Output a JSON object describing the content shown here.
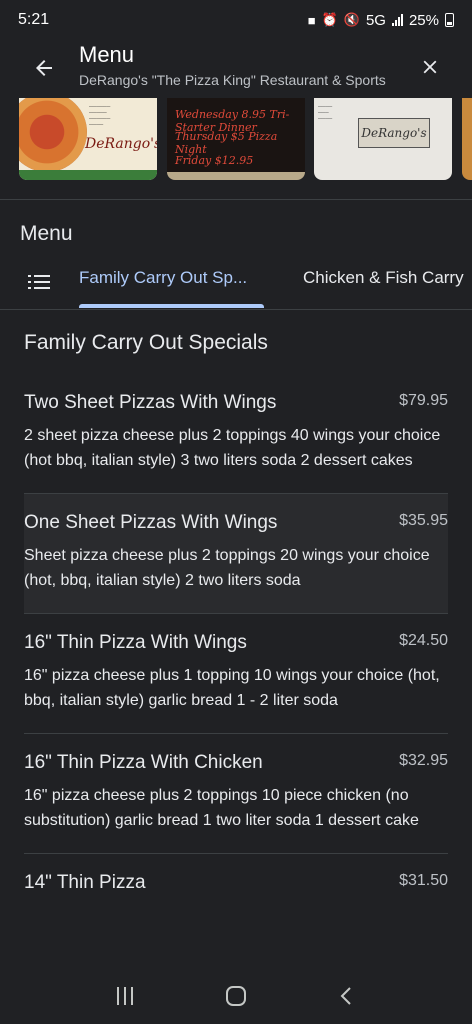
{
  "status_bar": {
    "time": "5:21",
    "network": "5G",
    "battery": "25%"
  },
  "header": {
    "title": "Menu",
    "subtitle": "DeRango's \"The Pizza King\" Restaurant & Sports"
  },
  "photos": {
    "photo1_logo": "DeRango's",
    "photo2_lines": [
      "Wednesday 8.95 Tri-Starter Dinner",
      "Thursday $5 Pizza Night",
      "Friday $12.95"
    ],
    "photo3_logo": "DeRango's"
  },
  "menu_heading": "Menu",
  "tabs": [
    {
      "label": "Family Carry Out Sp...",
      "active": true
    },
    {
      "label": "Chicken & Fish Carry",
      "active": false
    }
  ],
  "section": {
    "title": "Family Carry Out Specials",
    "items": [
      {
        "name": "Two Sheet Pizzas With Wings",
        "price": "$79.95",
        "description": "2 sheet pizza cheese plus 2 toppings 40 wings your choice (hot bbq, italian style) 3 two liters soda 2 dessert cakes"
      },
      {
        "name": "One Sheet Pizzas With Wings",
        "price": "$35.95",
        "description": "Sheet pizza cheese plus 2 toppings 20 wings your choice (hot, bbq, italian style) 2 two liters soda"
      },
      {
        "name": "16\" Thin Pizza With Wings",
        "price": "$24.50",
        "description": "16\" pizza cheese plus 1 topping 10 wings your choice (hot, bbq, italian style) garlic bread 1 - 2 liter soda"
      },
      {
        "name": "16\" Thin Pizza With Chicken",
        "price": "$32.95",
        "description": "16\" pizza cheese plus 2 toppings 10 piece chicken (no substitution) garlic bread 1 two liter soda 1 dessert cake"
      },
      {
        "name": "14\" Thin Pizza",
        "price": "$31.50",
        "description": ""
      }
    ]
  },
  "colors": {
    "background": "#202124",
    "accent": "#aecbfa",
    "divider": "#3c4043"
  }
}
